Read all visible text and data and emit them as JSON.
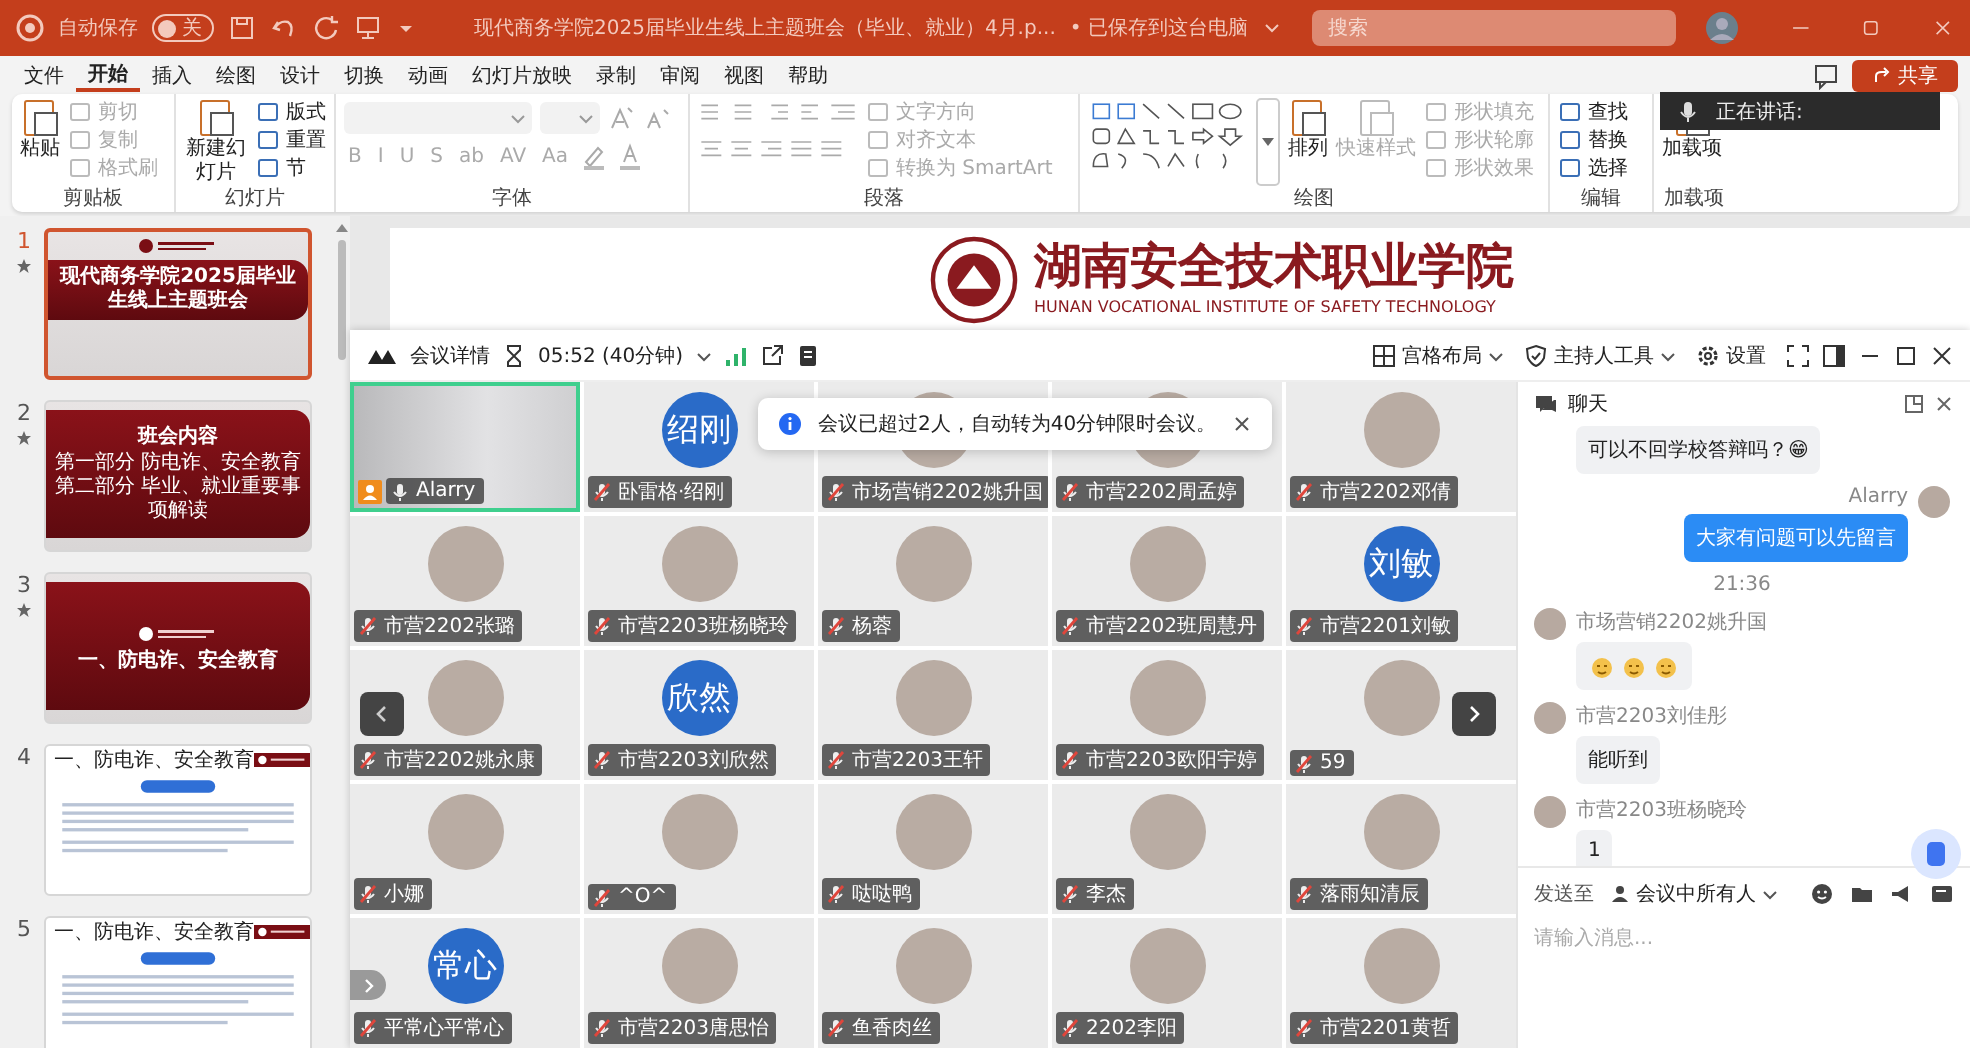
{
  "title_bar": {
    "autosave_label": "自动保存",
    "autosave_toggle": {
      "label": "关",
      "on": false
    },
    "document_title": "现代商务学院2025届毕业生线上主题班会（毕业、就业）4月.p...",
    "save_status": "• 已保存到这台电脑",
    "search_placeholder": "搜索"
  },
  "menu_tabs": [
    {
      "label": "文件",
      "selected": false
    },
    {
      "label": "开始",
      "selected": true
    },
    {
      "label": "插入",
      "selected": false
    },
    {
      "label": "绘图",
      "selected": false
    },
    {
      "label": "设计",
      "selected": false
    },
    {
      "label": "切换",
      "selected": false
    },
    {
      "label": "动画",
      "selected": false
    },
    {
      "label": "幻灯片放映",
      "selected": false
    },
    {
      "label": "录制",
      "selected": false
    },
    {
      "label": "审阅",
      "selected": false
    },
    {
      "label": "视图",
      "selected": false
    },
    {
      "label": "帮助",
      "selected": false
    }
  ],
  "share_button": "共享",
  "speaking_popup": {
    "label": "正在讲话:"
  },
  "ribbon": {
    "groups": [
      {
        "label": "剪贴板",
        "kind": "tools",
        "columns": [
          [
            {
              "label": "粘贴",
              "kind": "large",
              "disabled": false
            }
          ],
          [
            {
              "label": "剪切",
              "kind": "small",
              "disabled": true
            },
            {
              "label": "复制",
              "kind": "small",
              "disabled": true
            },
            {
              "label": "格式刷",
              "kind": "small",
              "disabled": true
            }
          ]
        ]
      },
      {
        "label": "幻灯片",
        "kind": "tools",
        "columns": [
          [
            {
              "label": "新建幻灯片",
              "kind": "large",
              "disabled": false
            }
          ],
          [
            {
              "label": "版式",
              "kind": "small",
              "disabled": false
            },
            {
              "label": "重置",
              "kind": "small",
              "disabled": false
            },
            {
              "label": "节",
              "kind": "small",
              "disabled": false
            }
          ]
        ]
      },
      {
        "label": "字体",
        "kind": "font",
        "buttons": [
          {
            "label": "B",
            "disabled": true
          },
          {
            "label": "I",
            "disabled": true
          },
          {
            "label": "U",
            "disabled": true
          },
          {
            "label": "S",
            "disabled": true
          },
          {
            "label": "ab",
            "disabled": true
          },
          {
            "label": "AV",
            "disabled": true
          },
          {
            "label": "Aa",
            "disabled": true
          }
        ]
      },
      {
        "label": "段落",
        "kind": "paragraph",
        "columns": [
          [
            {
              "label": "文字方向",
              "kind": "small",
              "disabled": true
            },
            {
              "label": "对齐文本",
              "kind": "small",
              "disabled": true
            },
            {
              "label": "转换为 SmartArt",
              "kind": "small",
              "disabled": true
            }
          ]
        ]
      },
      {
        "label": "绘图",
        "kind": "shapes",
        "columns": [
          [
            {
              "label": "排列",
              "kind": "large",
              "disabled": false
            }
          ],
          [
            {
              "label": "快速样式",
              "kind": "large",
              "disabled": true
            }
          ],
          [
            {
              "label": "形状填充",
              "kind": "small",
              "disabled": true
            },
            {
              "label": "形状轮廓",
              "kind": "small",
              "disabled": true
            },
            {
              "label": "形状效果",
              "kind": "small",
              "disabled": true
            }
          ]
        ]
      },
      {
        "label": "编辑",
        "kind": "tools",
        "columns": [
          [
            {
              "label": "查找",
              "kind": "small",
              "disabled": false
            },
            {
              "label": "替换",
              "kind": "small",
              "disabled": false
            },
            {
              "label": "选择",
              "kind": "small",
              "disabled": false
            }
          ]
        ]
      },
      {
        "label": "加载项",
        "kind": "tools",
        "columns": [
          [
            {
              "label": "加载项",
              "kind": "large",
              "disabled": false
            }
          ]
        ]
      }
    ]
  },
  "slides": [
    {
      "number": "1",
      "selected": true,
      "kind": "title",
      "has_animation": true,
      "title": "现代商务学院2025届毕业生线上主题班会"
    },
    {
      "number": "2",
      "selected": false,
      "kind": "agenda",
      "has_animation": true,
      "title": "班会内容",
      "lines": [
        "第一部分  防电诈、安全教育",
        "第二部分  毕业、就业重要事项解读"
      ]
    },
    {
      "number": "3",
      "selected": false,
      "kind": "section",
      "has_animation": true,
      "title": "一、防电诈、安全教育"
    },
    {
      "number": "4",
      "selected": false,
      "kind": "content",
      "has_animation": false,
      "title": "一、防电诈、安全教育"
    },
    {
      "number": "5",
      "selected": false,
      "kind": "content",
      "has_animation": false,
      "title": "一、防电诈、安全教育"
    }
  ],
  "slide_preview": {
    "school_name": "湖南安全技术职业学院",
    "school_name_en": "HUNAN VOCATIONAL INSTITUTE OF SAFETY TECHNOLOGY"
  },
  "meeting": {
    "details_label": "会议详情",
    "timer": "05:52 (40分钟)",
    "layout_label": "宫格布局",
    "host_tools_label": "主持人工具",
    "settings_label": "设置",
    "toast": "会议已超过2人，自动转为40分钟限时会议。",
    "participants": [
      {
        "name": "Alarry",
        "kind": "video",
        "muted": false,
        "host": true,
        "active": true
      },
      {
        "name": "卧雷格·绍刚",
        "kind": "initials",
        "initials": "绍刚",
        "muted": true,
        "host": false,
        "active": false
      },
      {
        "name": "市场营销2202姚升国",
        "kind": "photo",
        "muted": true,
        "host": false,
        "active": false
      },
      {
        "name": "市营2202周孟婷",
        "kind": "photo",
        "muted": true,
        "host": false,
        "active": false
      },
      {
        "name": "市营2202邓倩",
        "kind": "photo",
        "muted": true,
        "host": false,
        "active": false
      },
      {
        "name": "市营2202张璐",
        "kind": "photo",
        "muted": true,
        "host": false,
        "active": false
      },
      {
        "name": "市营2203班杨晓玲",
        "kind": "photo",
        "muted": true,
        "host": false,
        "active": false
      },
      {
        "name": "杨蓉",
        "kind": "photo",
        "muted": true,
        "host": false,
        "active": false
      },
      {
        "name": "市营2202班周慧丹",
        "kind": "photo",
        "muted": true,
        "host": false,
        "active": false
      },
      {
        "name": "市营2201刘敏",
        "kind": "initials",
        "initials": "刘敏",
        "muted": true,
        "host": false,
        "active": false
      },
      {
        "name": "市营2202姚永康",
        "kind": "photo",
        "muted": true,
        "host": false,
        "active": false
      },
      {
        "name": "市营2203刘欣然",
        "kind": "initials",
        "initials": "欣然",
        "muted": true,
        "host": false,
        "active": false
      },
      {
        "name": "市营2203王轩",
        "kind": "photo",
        "muted": true,
        "host": false,
        "active": false
      },
      {
        "name": "市营2203欧阳宇婷",
        "kind": "photo",
        "muted": true,
        "host": false,
        "active": false
      },
      {
        "name": "59",
        "kind": "photo",
        "muted": true,
        "host": false,
        "active": false
      },
      {
        "name": "小娜",
        "kind": "photo",
        "muted": true,
        "host": false,
        "active": false
      },
      {
        "name": "^O^",
        "kind": "photo",
        "muted": true,
        "host": false,
        "active": false
      },
      {
        "name": "哒哒鸭",
        "kind": "photo",
        "muted": true,
        "host": false,
        "active": false
      },
      {
        "name": "李杰",
        "kind": "photo",
        "muted": true,
        "host": false,
        "active": false
      },
      {
        "name": "落雨知清辰",
        "kind": "photo",
        "muted": true,
        "host": false,
        "active": false
      },
      {
        "name": "平常心平常心",
        "kind": "initials",
        "initials": "常心",
        "muted": true,
        "host": false,
        "active": false
      },
      {
        "name": "市营2203唐思怡",
        "kind": "photo",
        "muted": true,
        "host": false,
        "active": false
      },
      {
        "name": "鱼香肉丝",
        "kind": "photo",
        "muted": true,
        "host": false,
        "active": false
      },
      {
        "name": "2202李阳",
        "kind": "photo",
        "muted": true,
        "host": false,
        "active": false
      },
      {
        "name": "市营2201黄哲",
        "kind": "photo",
        "muted": true,
        "host": false,
        "active": false
      }
    ]
  },
  "chat": {
    "title": "聊天",
    "messages": [
      {
        "kind": "incoming",
        "text": "可以不回学校答辩吗？😁"
      },
      {
        "kind": "outgoing",
        "sender": "Alarry",
        "text": "大家有问题可以先留言"
      },
      {
        "kind": "time",
        "text": "21:36"
      },
      {
        "kind": "sticker",
        "sender": "市场营销2202姚升国"
      },
      {
        "kind": "incoming",
        "sender": "市营2203刘佳彤",
        "text": "能听到"
      },
      {
        "kind": "incoming",
        "sender": "市营2203班杨晓玲",
        "text": "1"
      }
    ],
    "send_to_label": "发送至",
    "recipient": "会议中所有人",
    "placeholder": "请输入消息..."
  }
}
